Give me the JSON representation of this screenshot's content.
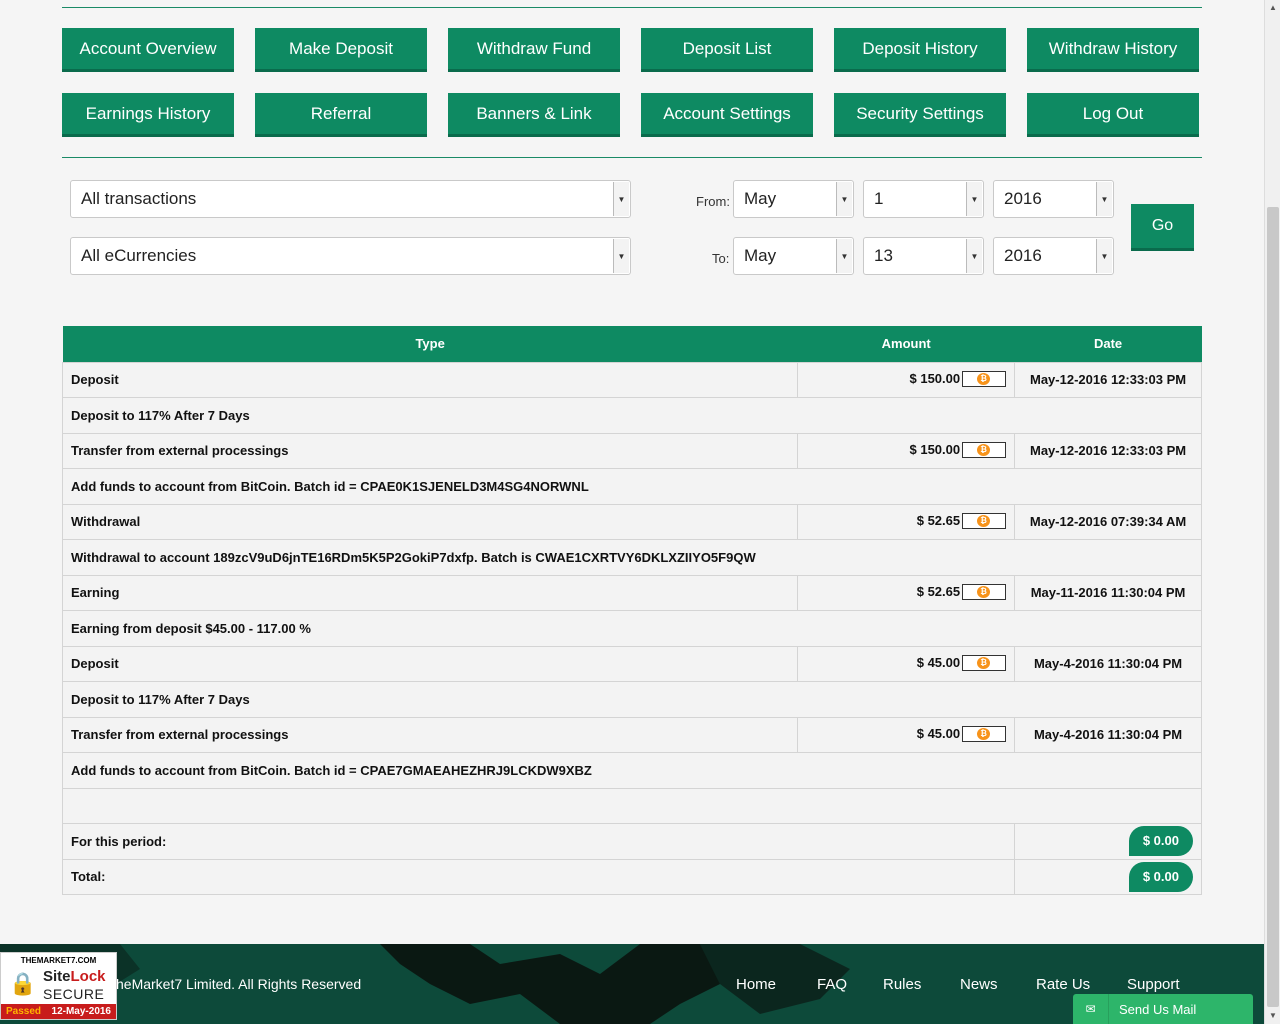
{
  "nav": {
    "row1": [
      "Account Overview",
      "Make Deposit",
      "Withdraw Fund",
      "Deposit List",
      "Deposit History",
      "Withdraw History"
    ],
    "row2": [
      "Earnings History",
      "Referral",
      "Banners & Link",
      "Account Settings",
      "Security Settings",
      "Log Out"
    ]
  },
  "filters": {
    "type_select": "All transactions",
    "currency_select": "All eCurrencies",
    "from_label": "From:",
    "to_label": "To:",
    "from_month": "May",
    "from_day": "1",
    "from_year": "2016",
    "to_month": "May",
    "to_day": "13",
    "to_year": "2016",
    "go_label": "Go"
  },
  "table": {
    "headers": {
      "type": "Type",
      "amount": "Amount",
      "date": "Date"
    },
    "rows": [
      {
        "type": "Deposit",
        "amount": "$ 150.00",
        "date": "May-12-2016 12:33:03 PM",
        "desc": "Deposit to 117% After 7 Days"
      },
      {
        "type": "Transfer from external processings",
        "amount": "$ 150.00",
        "date": "May-12-2016 12:33:03 PM",
        "desc": "Add funds to account from BitCoin. Batch id = CPAE0K1SJENELD3M4SG4NORWNL"
      },
      {
        "type": "Withdrawal",
        "amount": "$ 52.65",
        "date": "May-12-2016 07:39:34 AM",
        "desc": "Withdrawal to account 189zcV9uD6jnTE16RDm5K5P2GokiP7dxfp. Batch is CWAE1CXRTVY6DKLXZIIYO5F9QW"
      },
      {
        "type": "Earning",
        "amount": "$ 52.65",
        "date": "May-11-2016 11:30:04 PM",
        "desc": "Earning from deposit $45.00 - 117.00 %"
      },
      {
        "type": "Deposit",
        "amount": "$ 45.00",
        "date": "May-4-2016 11:30:04 PM",
        "desc": "Deposit to 117% After 7 Days"
      },
      {
        "type": "Transfer from external processings",
        "amount": "$ 45.00",
        "date": "May-4-2016 11:30:04 PM",
        "desc": "Add funds to account from BitCoin. Batch id = CPAE7GMAEAHEZHRJ9LCKDW9XBZ"
      }
    ],
    "period_label": "For this period:",
    "period_value": "$ 0.00",
    "total_label": "Total:",
    "total_value": "$ 0.00"
  },
  "footer": {
    "copyright": "heMarket7 Limited. All Rights Reserved",
    "links": [
      "Home",
      "FAQ",
      "Rules",
      "News",
      "Rate Us",
      "Support"
    ],
    "mail_label": "Send Us Mail"
  },
  "sitelock": {
    "domain": "THEMARKET7.COM",
    "brand_a": "Site",
    "brand_b": "Lock",
    "secure": "SECURE",
    "passed": "Passed",
    "date": "12-May-2016"
  },
  "colors": {
    "accent": "#0e8a62",
    "footer": "#0d4a3a",
    "mail": "#2db56a",
    "bitcoin": "#f7931a"
  }
}
